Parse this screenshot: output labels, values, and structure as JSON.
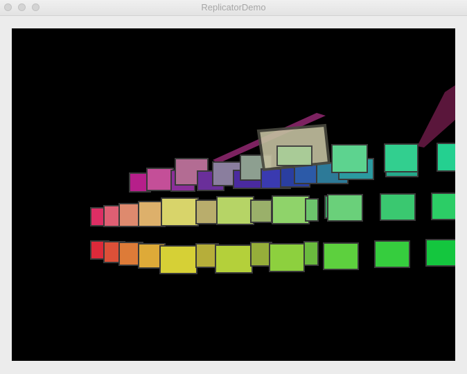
{
  "window": {
    "title": "ReplicatorDemo",
    "controls": [
      "close-button",
      "minimize-button",
      "zoom-button"
    ]
  },
  "scene": {
    "background": "#000000",
    "description_colors": [
      "#e0264f",
      "#d8b250",
      "#c9c84a",
      "#8fd14f",
      "#2fcf44",
      "#56d8a0",
      "#b13a86"
    ]
  }
}
